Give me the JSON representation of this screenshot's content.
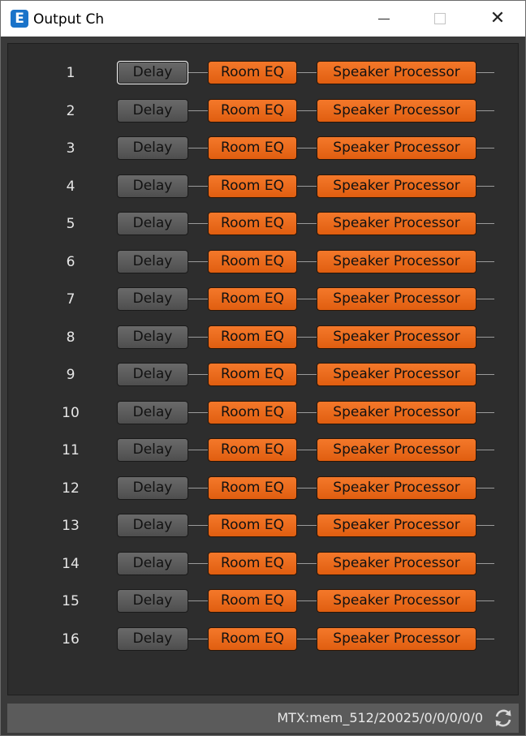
{
  "window": {
    "title": "Output Ch",
    "app_icon_letter": "E",
    "controls": {
      "minimize_icon": "minimize-icon",
      "maximize_icon": "maximize-icon",
      "close_glyph": "✕"
    }
  },
  "channels": [
    {
      "number": "1",
      "delay": "Delay",
      "room_eq": "Room EQ",
      "speaker_processor": "Speaker Processor"
    },
    {
      "number": "2",
      "delay": "Delay",
      "room_eq": "Room EQ",
      "speaker_processor": "Speaker Processor"
    },
    {
      "number": "3",
      "delay": "Delay",
      "room_eq": "Room EQ",
      "speaker_processor": "Speaker Processor"
    },
    {
      "number": "4",
      "delay": "Delay",
      "room_eq": "Room EQ",
      "speaker_processor": "Speaker Processor"
    },
    {
      "number": "5",
      "delay": "Delay",
      "room_eq": "Room EQ",
      "speaker_processor": "Speaker Processor"
    },
    {
      "number": "6",
      "delay": "Delay",
      "room_eq": "Room EQ",
      "speaker_processor": "Speaker Processor"
    },
    {
      "number": "7",
      "delay": "Delay",
      "room_eq": "Room EQ",
      "speaker_processor": "Speaker Processor"
    },
    {
      "number": "8",
      "delay": "Delay",
      "room_eq": "Room EQ",
      "speaker_processor": "Speaker Processor"
    },
    {
      "number": "9",
      "delay": "Delay",
      "room_eq": "Room EQ",
      "speaker_processor": "Speaker Processor"
    },
    {
      "number": "10",
      "delay": "Delay",
      "room_eq": "Room EQ",
      "speaker_processor": "Speaker Processor"
    },
    {
      "number": "11",
      "delay": "Delay",
      "room_eq": "Room EQ",
      "speaker_processor": "Speaker Processor"
    },
    {
      "number": "12",
      "delay": "Delay",
      "room_eq": "Room EQ",
      "speaker_processor": "Speaker Processor"
    },
    {
      "number": "13",
      "delay": "Delay",
      "room_eq": "Room EQ",
      "speaker_processor": "Speaker Processor"
    },
    {
      "number": "14",
      "delay": "Delay",
      "room_eq": "Room EQ",
      "speaker_processor": "Speaker Processor"
    },
    {
      "number": "15",
      "delay": "Delay",
      "room_eq": "Room EQ",
      "speaker_processor": "Speaker Processor"
    },
    {
      "number": "16",
      "delay": "Delay",
      "room_eq": "Room EQ",
      "speaker_processor": "Speaker Processor"
    }
  ],
  "focused_channel": "1",
  "status": {
    "text": "MTX:mem_512/20025/0/0/0/0/0",
    "icon": "sync-icon"
  },
  "colors": {
    "accent_orange": "#f0691c",
    "delay_gray": "#5c5c5c",
    "panel_bg": "#2d2d2d",
    "app_icon_blue": "#1a73c9"
  }
}
